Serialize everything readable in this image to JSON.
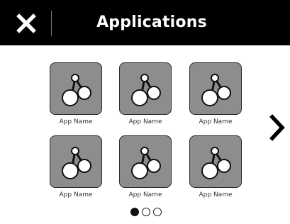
{
  "header": {
    "title": "Applications",
    "close_icon": "close-icon",
    "background": "#000000",
    "text_color": "#ffffff"
  },
  "apps": [
    {
      "label": "App Name",
      "icon": "app-molecule-icon"
    },
    {
      "label": "App Name",
      "icon": "app-molecule-icon"
    },
    {
      "label": "App Name",
      "icon": "app-molecule-icon"
    },
    {
      "label": "App Name",
      "icon": "app-molecule-icon"
    },
    {
      "label": "App Name",
      "icon": "app-molecule-icon"
    },
    {
      "label": "App Name",
      "icon": "app-molecule-icon"
    }
  ],
  "tile_color": "#8d8d8d",
  "next_icon": "chevron-right-icon",
  "pager": {
    "total_pages": 3,
    "current_page": 1
  }
}
